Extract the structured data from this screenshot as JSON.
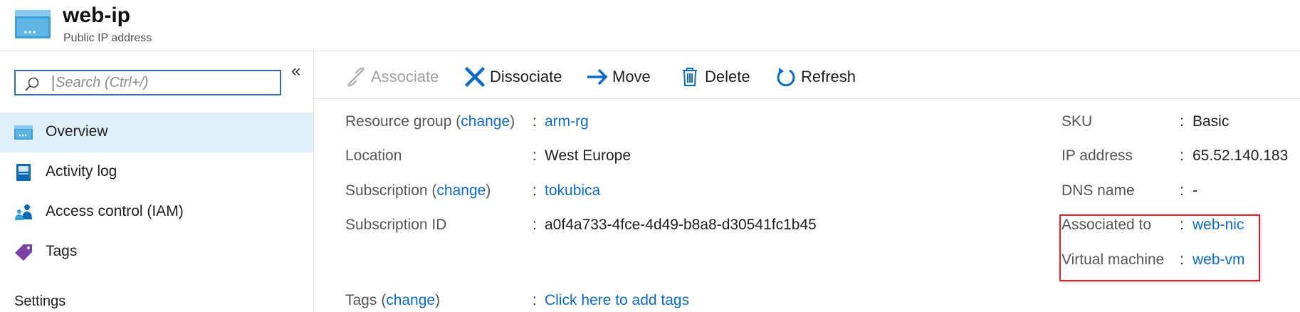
{
  "resource": {
    "name": "web-ip",
    "type": "Public IP address",
    "icon": "public-ip-address-icon"
  },
  "sidebar": {
    "search_placeholder": "Search (Ctrl+/)",
    "collapse_glyph": "«",
    "items": [
      {
        "label": "Overview",
        "icon": "overview-icon",
        "active": true
      },
      {
        "label": "Activity log",
        "icon": "activity-log-icon",
        "active": false
      },
      {
        "label": "Access control (IAM)",
        "icon": "access-control-icon",
        "active": false
      },
      {
        "label": "Tags",
        "icon": "tag-icon",
        "active": false
      }
    ],
    "section_header": "Settings"
  },
  "toolbar": {
    "associate": "Associate",
    "dissociate": "Dissociate",
    "move": "Move",
    "delete": "Delete",
    "refresh": "Refresh"
  },
  "essentials": {
    "left": [
      {
        "label": "Resource group",
        "change": "change",
        "value": "arm-rg",
        "value_is_link": true
      },
      {
        "label": "Location",
        "change": "",
        "value": "West Europe",
        "value_is_link": false
      },
      {
        "label": "Subscription",
        "change": "change",
        "value": "tokubica",
        "value_is_link": true
      },
      {
        "label": "Subscription ID",
        "change": "",
        "value": "a0f4a733-4fce-4d49-b8a8-d30541fc1b45",
        "value_is_link": false
      }
    ],
    "tags": {
      "label": "Tags",
      "change": "change",
      "value": "Click here to add tags"
    },
    "right": [
      {
        "label": "SKU",
        "value": "Basic",
        "value_is_link": false
      },
      {
        "label": "IP address",
        "value": "65.52.140.183",
        "value_is_link": false
      },
      {
        "label": "DNS name",
        "value": "-",
        "value_is_link": false
      },
      {
        "label": "Associated to",
        "value": "web-nic",
        "value_is_link": true
      },
      {
        "label": "Virtual machine",
        "value": "web-vm",
        "value_is_link": true
      }
    ]
  },
  "colors": {
    "accent": "#0b6bcb",
    "active_nav": "#dff0fb",
    "highlight_border": "#d9222a"
  }
}
